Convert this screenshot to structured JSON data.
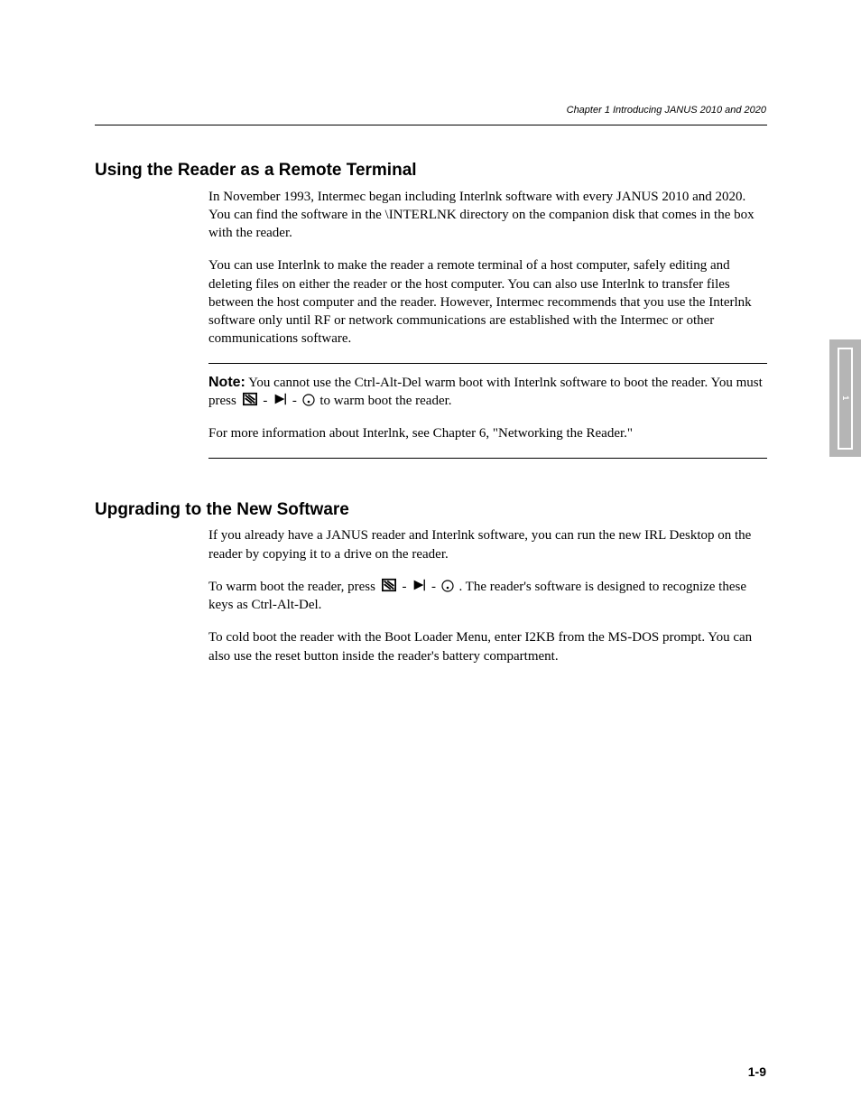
{
  "header": {
    "title": "Chapter 1   Introducing JANUS 2010 and 2020",
    "page_number": "1-9"
  },
  "side_tab": {
    "label": "1"
  },
  "sections": {
    "using_reader": {
      "heading": "Using the Reader as a Remote Terminal",
      "p1": "In November 1993, Intermec began including Interlnk software with every JANUS 2010 and 2020. You can find the software in the \\INTERLNK directory on the companion disk that comes in the box with the reader.",
      "p2": "You can use Interlnk to make the reader a remote terminal of a host computer, safely editing and deleting files on either the reader or the host computer. You can also use Interlnk to transfer files between the host computer and the reader. However, Intermec recommends that you use the Interlnk software only until RF or network communications are established with the Intermec or other communications software."
    },
    "note": {
      "heading": "Note:",
      "text": "You cannot use the Ctrl-Alt-Del warm boot with Interlnk software to boot the reader. You must press ",
      "key1": "-",
      "key2": "-",
      "key3": ".",
      "text2": " to warm boot the reader.",
      "p2": "For more information about Interlnk, see Chapter 6, \"Networking the Reader.\""
    },
    "upgrading": {
      "heading": "Upgrading to the New Software",
      "p1": "If you already have a JANUS reader and Interlnk software, you can run the new IRL Desktop on the reader by copying it to a drive on the reader.",
      "p2_a": "To warm boot the reader, press ",
      "key1": "-",
      "key2": "-",
      "key3": ".",
      "p2_b": ". The reader's software is designed to recognize these keys as Ctrl-Alt-Del.",
      "p3": "To cold boot the reader with the Boot Loader Menu, enter I2KB from the MS-DOS prompt. You can also use the reset button inside the reader's battery compartment."
    }
  },
  "icons": {
    "ctrl_icon": "ctrl-key-icon",
    "alt_icon": "alt-key-icon",
    "dot_icon": "period-key-icon"
  }
}
